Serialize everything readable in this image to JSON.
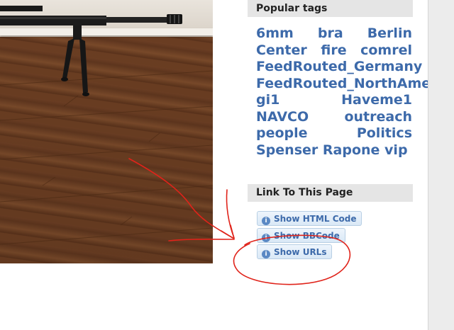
{
  "sidebar": {
    "popular_tags_title": "Popular tags",
    "tags": [
      "6mm",
      "bra",
      "Berlin",
      "Center",
      "fire",
      "comrel",
      "FeedRouted_Germany",
      "FeedRouted_NorthAmerica",
      "gi1",
      "Haveme1",
      "NAVCO",
      "outreach",
      "people",
      "Politics",
      "Spenser",
      "Rapone",
      "vip"
    ],
    "link_title": "Link To This Page",
    "buttons": {
      "html": "Show HTML Code",
      "bbcode": "Show BBCode",
      "urls": "Show URLs"
    }
  },
  "icons": {
    "info": "info-icon"
  },
  "colors": {
    "tag_link": "#3d6aaa",
    "header_bg": "#e5e5e5",
    "annotation": "#e0231a",
    "floor": "#6b3e22"
  }
}
